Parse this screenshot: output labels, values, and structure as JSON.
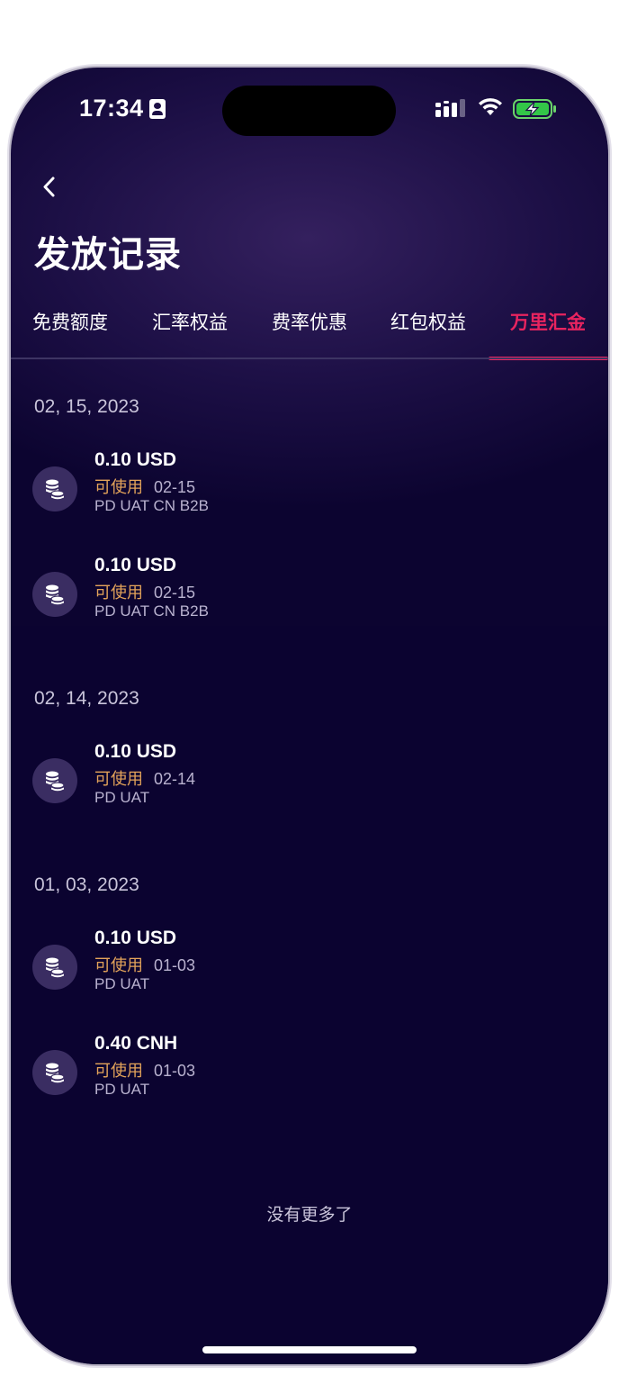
{
  "status_bar": {
    "time": "17:34",
    "icons": [
      "contact-card-icon",
      "signal-icon",
      "wifi-icon",
      "battery-charging-icon"
    ]
  },
  "header": {
    "back_icon": "chevron-left-icon",
    "title": "发放记录"
  },
  "tabs": [
    {
      "label": "免费额度",
      "active": false
    },
    {
      "label": "汇率权益",
      "active": false
    },
    {
      "label": "费率优惠",
      "active": false
    },
    {
      "label": "红包权益",
      "active": false
    },
    {
      "label": "万里汇金",
      "active": true
    }
  ],
  "groups": [
    {
      "date": "02, 15, 2023",
      "records": [
        {
          "amount": "0.10 USD",
          "status": "可使用",
          "date": "02-15",
          "source": "PD UAT CN B2B"
        },
        {
          "amount": "0.10 USD",
          "status": "可使用",
          "date": "02-15",
          "source": "PD UAT CN B2B"
        }
      ]
    },
    {
      "date": "02, 14, 2023",
      "records": [
        {
          "amount": "0.10 USD",
          "status": "可使用",
          "date": "02-14",
          "source": "PD UAT"
        }
      ]
    },
    {
      "date": "01, 03, 2023",
      "records": [
        {
          "amount": "0.10 USD",
          "status": "可使用",
          "date": "01-03",
          "source": "PD UAT"
        },
        {
          "amount": "0.40 CNH",
          "status": "可使用",
          "date": "01-03",
          "source": "PD UAT"
        }
      ]
    }
  ],
  "footer": {
    "no_more": "没有更多了"
  },
  "colors": {
    "background": "#0b0330",
    "accent": "#e8245f",
    "status_usable": "#e3a35a"
  }
}
